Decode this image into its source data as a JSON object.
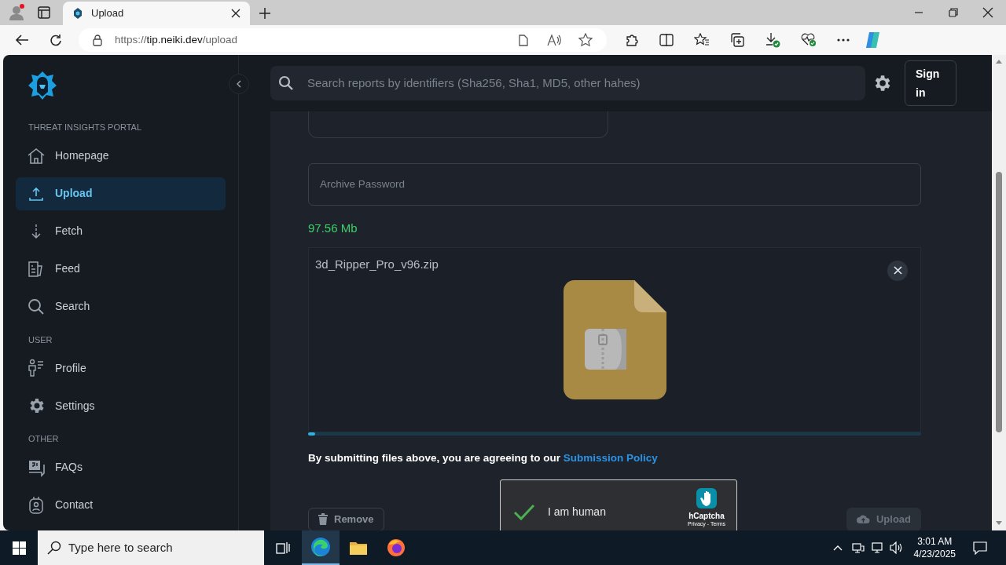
{
  "browser": {
    "tab": {
      "title": "Upload"
    },
    "address": {
      "scheme": "https://",
      "host": "tip.neiki.dev",
      "path": "/upload"
    }
  },
  "sidebar": {
    "sections": [
      {
        "heading": "THREAT INSIGHTS PORTAL",
        "items": [
          {
            "label": "Homepage",
            "kind": "home",
            "selected": false
          },
          {
            "label": "Upload",
            "kind": "upload",
            "selected": true
          },
          {
            "label": "Fetch",
            "kind": "fetch",
            "selected": false
          },
          {
            "label": "Feed",
            "kind": "feed",
            "selected": false
          },
          {
            "label": "Search",
            "kind": "search",
            "selected": false
          }
        ]
      },
      {
        "heading": "USER",
        "items": [
          {
            "label": "Profile",
            "kind": "profile",
            "selected": false
          },
          {
            "label": "Settings",
            "kind": "gear",
            "selected": false
          }
        ]
      },
      {
        "heading": "OTHER",
        "items": [
          {
            "label": "FAQs",
            "kind": "faq",
            "selected": false
          },
          {
            "label": "Contact",
            "kind": "contact",
            "selected": false
          }
        ]
      }
    ]
  },
  "header": {
    "search": {
      "placeholder": "Search reports by identifiers (Sha256, Sha1, MD5, other hahes)"
    },
    "sign_in": "Sign in"
  },
  "form": {
    "password": {
      "placeholder": "Archive Password"
    },
    "size": "97.56 Mb",
    "file": {
      "name": "3d_Ripper_Pro_v96.zip"
    },
    "progress": {
      "level": 0.012
    },
    "agreement": {
      "text": "By submitting files above, you are agreeing to our",
      "link": "Submission Policy"
    },
    "captcha": {
      "checked": true,
      "label": "I am human",
      "brand": "hCaptcha",
      "links": "Privacy - Terms"
    },
    "buttons": [
      {
        "kind": "remove",
        "label": "Remove",
        "disabled": false
      },
      {
        "kind": "upload",
        "label": "Upload",
        "disabled": true
      }
    ]
  },
  "taskbar": {
    "search": {
      "placeholder": "Type here to search"
    },
    "time": "3:01 AM",
    "date": "4/23/2025"
  }
}
